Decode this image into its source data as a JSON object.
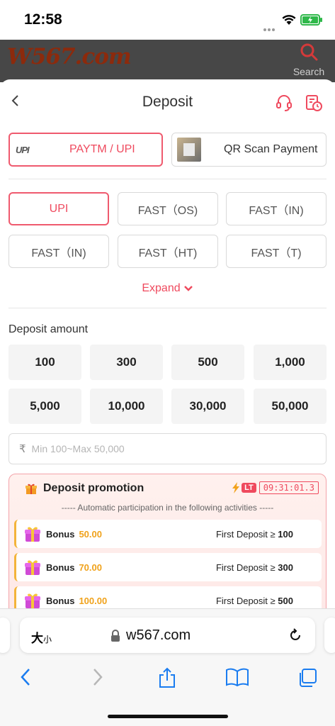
{
  "status_bar": {
    "time": "12:58"
  },
  "site": {
    "logo_text": "W567.com",
    "search_label": "Search"
  },
  "sheet": {
    "title": "Deposit"
  },
  "methods": [
    {
      "logo": "UPI",
      "label": "PAYTM / UPI",
      "selected": true
    },
    {
      "label": "QR Scan Payment",
      "selected": false
    }
  ],
  "channels": [
    {
      "label": "UPI",
      "selected": true
    },
    {
      "label": "FAST（OS)",
      "selected": false
    },
    {
      "label": "FAST（IN)",
      "selected": false
    },
    {
      "label": "FAST（IN)",
      "selected": false
    },
    {
      "label": "FAST（HT)",
      "selected": false
    },
    {
      "label": "FAST（T)",
      "selected": false
    }
  ],
  "expand_label": "Expand",
  "amount": {
    "title": "Deposit amount",
    "options": [
      "100",
      "300",
      "500",
      "1,000",
      "5,000",
      "10,000",
      "30,000",
      "50,000"
    ],
    "currency_symbol": "₹",
    "placeholder": "Min 100~Max 50,000",
    "value": ""
  },
  "promotion": {
    "title": "Deposit promotion",
    "badge": "LT",
    "timer": "09:31:01.3",
    "subtitle": "----- Automatic participation in the following activities -----",
    "rows": [
      {
        "bonus_label": "Bonus",
        "bonus_value": "50.00",
        "condition_label": "First Deposit ≥",
        "condition_value": "100"
      },
      {
        "bonus_label": "Bonus",
        "bonus_value": "70.00",
        "condition_label": "First Deposit ≥",
        "condition_value": "300"
      },
      {
        "bonus_label": "Bonus",
        "bonus_value": "100.00",
        "condition_label": "First Deposit ≥",
        "condition_value": "500"
      }
    ]
  },
  "browser": {
    "text_size_big": "大",
    "text_size_small": "小",
    "url": "w567.com"
  },
  "colors": {
    "accent": "#ef4a5e",
    "bonus": "#f0a21b",
    "header": "#474747"
  }
}
